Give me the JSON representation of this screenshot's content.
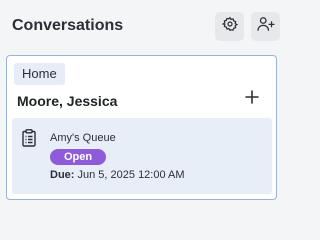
{
  "header": {
    "title": "Conversations",
    "settings_icon": "gear-icon",
    "add_user_icon": "add-user-icon"
  },
  "card": {
    "chip": "Home",
    "contact_name": "Moore, Jessica",
    "add_icon": "plus-icon",
    "task": {
      "icon": "clipboard-icon",
      "queue": "Amy's Queue",
      "status": "Open",
      "due_label": "Due:",
      "due_value": "Jun 5, 2025 12:00 AM"
    }
  },
  "colors": {
    "accent_border": "#9ab3d8",
    "task_background": "#e8eef8",
    "status_open": "#8e5cd9"
  }
}
